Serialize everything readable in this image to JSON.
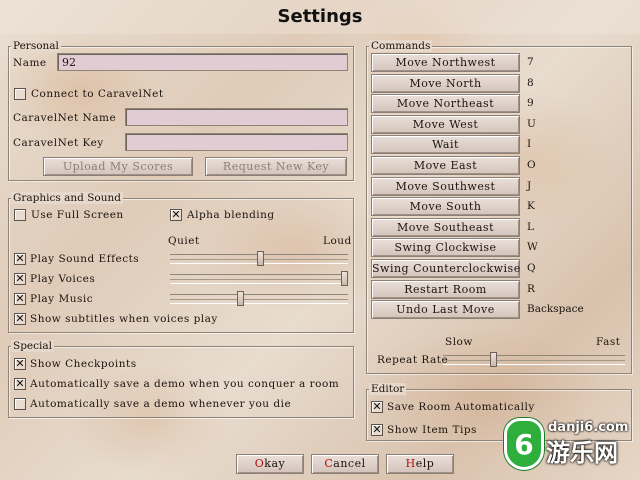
{
  "title": "Settings",
  "personal": {
    "label": "Personal",
    "name_label": "Name",
    "name_value": "92",
    "connect_label": "Connect to CaravelNet",
    "connect_checked": false,
    "caravelnet_name_label": "CaravelNet Name",
    "caravelnet_name_value": "",
    "caravelnet_key_label": "CaravelNet Key",
    "caravelnet_key_value": "",
    "upload_label": "Upload My Scores",
    "request_key_label": "Request New Key"
  },
  "graphics": {
    "label": "Graphics and Sound",
    "fullscreen_label": "Use Full Screen",
    "fullscreen_checked": false,
    "alpha_label": "Alpha blending",
    "alpha_checked": true,
    "quiet_label": "Quiet",
    "loud_label": "Loud",
    "sound_label": "Play Sound Effects",
    "sound_checked": true,
    "sound_level": 0.51,
    "voices_label": "Play Voices",
    "voices_checked": true,
    "voices_level": 1.0,
    "music_label": "Play Music",
    "music_checked": true,
    "music_level": 0.39,
    "subtitles_label": "Show subtitles when voices play",
    "subtitles_checked": true
  },
  "special": {
    "label": "Special",
    "checkpoints_label": "Show Checkpoints",
    "checkpoints_checked": true,
    "auto_demo_conquer_label": "Automatically save a demo when you conquer a room",
    "auto_demo_conquer_checked": true,
    "auto_demo_die_label": "Automatically save a demo whenever you die",
    "auto_demo_die_checked": false
  },
  "commands": {
    "label": "Commands",
    "items": [
      {
        "label": "Move Northwest",
        "key": "7"
      },
      {
        "label": "Move North",
        "key": "8"
      },
      {
        "label": "Move Northeast",
        "key": "9"
      },
      {
        "label": "Move West",
        "key": "U"
      },
      {
        "label": "Wait",
        "key": "I"
      },
      {
        "label": "Move East",
        "key": "O"
      },
      {
        "label": "Move Southwest",
        "key": "J"
      },
      {
        "label": "Move South",
        "key": "K"
      },
      {
        "label": "Move Southeast",
        "key": "L"
      },
      {
        "label": "Swing Clockwise",
        "key": "W"
      },
      {
        "label": "Swing Counterclockwise",
        "key": "Q"
      },
      {
        "label": "Restart Room",
        "key": "R"
      },
      {
        "label": "Undo Last Move",
        "key": "Backspace"
      }
    ],
    "slow_label": "Slow",
    "fast_label": "Fast",
    "repeat_rate_label": "Repeat Rate",
    "repeat_rate_level": 0.27
  },
  "editor": {
    "label": "Editor",
    "save_room_label": "Save Room Automatically",
    "save_room_checked": true,
    "item_tips_label": "Show Item Tips",
    "item_tips_checked": true
  },
  "footer": {
    "okay_hot": "O",
    "okay_rest": "kay",
    "cancel_hot": "C",
    "cancel_rest": "ancel",
    "help_hot": "H",
    "help_rest": "elp"
  },
  "watermark": {
    "site": "danji6.com",
    "name": "游乐网",
    "badge": "6"
  },
  "colors": {
    "hotkey": "#b01010",
    "watermark_green": "#2eae3a"
  }
}
